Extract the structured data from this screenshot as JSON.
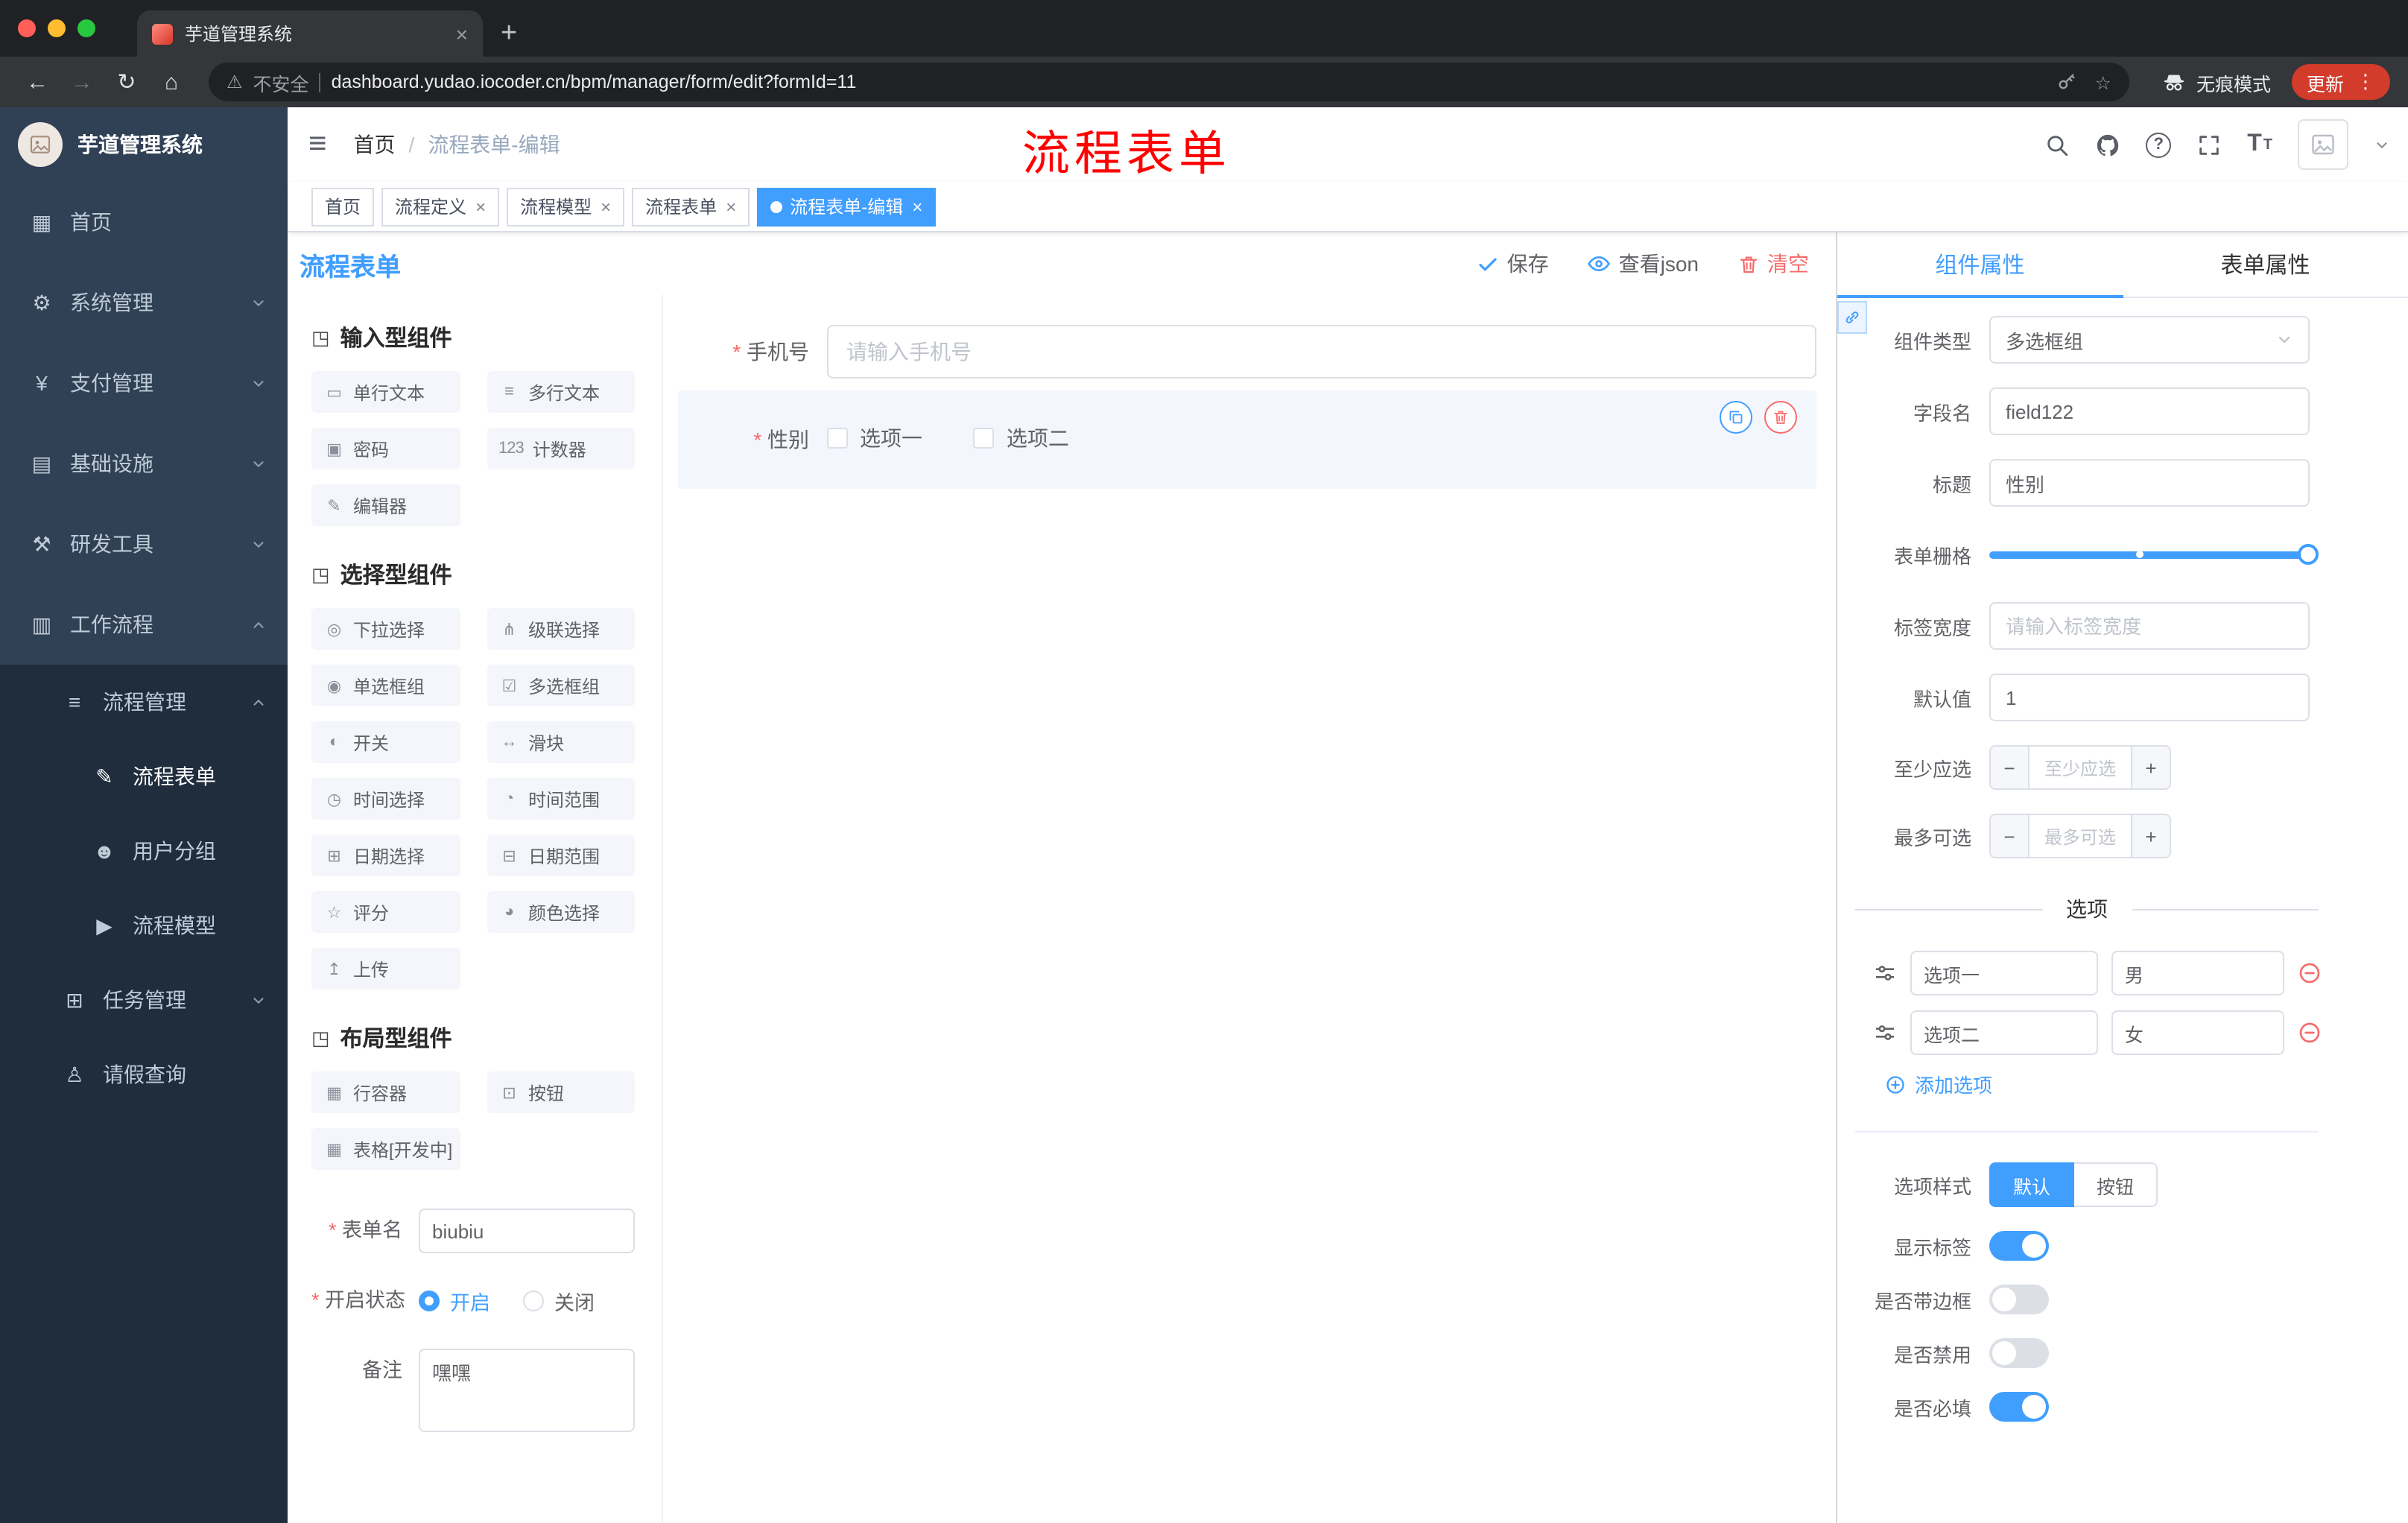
{
  "glyphs": {
    "close": "×",
    "plus": "+",
    "help": "?",
    "font_size": "T",
    "hamburger": "≡",
    "back": "←",
    "forward": "→",
    "reload": "↻",
    "home": "⌂",
    "warning": "⚠",
    "star": "☆",
    "dots": "⋮",
    "minus": "−"
  },
  "browser": {
    "tab": {
      "title": "芋道管理系统"
    },
    "security_label": "不安全",
    "url": "dashboard.yudao.iocoder.cn/bpm/manager/form/edit?formId=11",
    "incognito_label": "无痕模式",
    "update_label": "更新"
  },
  "sidebar": {
    "title": "芋道管理系统",
    "items": [
      {
        "label": "首页",
        "glyph": "▦"
      },
      {
        "label": "系统管理",
        "glyph": "⚙"
      },
      {
        "label": "支付管理",
        "glyph": "¥"
      },
      {
        "label": "基础设施",
        "glyph": "▤"
      },
      {
        "label": "研发工具",
        "glyph": "⚒"
      },
      {
        "label": "工作流程",
        "glyph": "▥"
      },
      {
        "label": "流程管理",
        "glyph": "≡"
      },
      {
        "label": "流程表单",
        "glyph": "✎"
      },
      {
        "label": "用户分组",
        "glyph": "☻"
      },
      {
        "label": "流程模型",
        "glyph": "▶"
      },
      {
        "label": "任务管理",
        "glyph": "⊞"
      },
      {
        "label": "请假查询",
        "glyph": "♙"
      }
    ]
  },
  "header": {
    "breadcrumb_home": "首页",
    "breadcrumb_sep": "/",
    "breadcrumb_current": "流程表单-编辑",
    "overlay_title": "流程表单"
  },
  "tags": [
    {
      "label": "首页"
    },
    {
      "label": "流程定义"
    },
    {
      "label": "流程模型"
    },
    {
      "label": "流程表单"
    },
    {
      "label": "流程表单-编辑"
    }
  ],
  "editor": {
    "title": "流程表单",
    "save": "保存",
    "view_json": "查看json",
    "clear": "清空",
    "palette": {
      "section_glyph": "◳",
      "sections": [
        {
          "title": "输入型组件",
          "items": [
            {
              "label": "单行文本",
              "glyph": "▭"
            },
            {
              "label": "多行文本",
              "glyph": "≡"
            },
            {
              "label": "密码",
              "glyph": "▣"
            },
            {
              "label": "计数器",
              "glyph": "123"
            },
            {
              "label": "编辑器",
              "glyph": "✎"
            }
          ]
        },
        {
          "title": "选择型组件",
          "items": [
            {
              "label": "下拉选择",
              "glyph": "◎"
            },
            {
              "label": "级联选择",
              "glyph": "⋔"
            },
            {
              "label": "单选框组",
              "glyph": "◉"
            },
            {
              "label": "多选框组",
              "glyph": "☑"
            },
            {
              "label": "开关",
              "glyph": "◐"
            },
            {
              "label": "滑块",
              "glyph": "↔"
            },
            {
              "label": "时间选择",
              "glyph": "◷"
            },
            {
              "label": "时间范围",
              "glyph": "◔"
            },
            {
              "label": "日期选择",
              "glyph": "⊞"
            },
            {
              "label": "日期范围",
              "glyph": "⊟"
            },
            {
              "label": "评分",
              "glyph": "☆"
            },
            {
              "label": "颜色选择",
              "glyph": "◕"
            },
            {
              "label": "上传",
              "glyph": "↥"
            }
          ]
        },
        {
          "title": "布局型组件",
          "items": [
            {
              "label": "行容器",
              "glyph": "▦"
            },
            {
              "label": "按钮",
              "glyph": "⊡"
            },
            {
              "label": "表格[开发中]",
              "glyph": "▦"
            }
          ]
        }
      ]
    },
    "meta": {
      "form_name_label": "表单名",
      "form_name_value": "biubiu",
      "status_label": "开启状态",
      "status_on": "开启",
      "status_off": "关闭",
      "remark_label": "备注",
      "remark_value": "嘿嘿"
    },
    "canvas": {
      "phone_label": "手机号",
      "phone_placeholder": "请输入手机号",
      "gender_label": "性别",
      "gender_option1": "选项一",
      "gender_option2": "选项二"
    }
  },
  "props": {
    "tab_component": "组件属性",
    "tab_form": "表单属性",
    "component_type_label": "组件类型",
    "component_type_value": "多选框组",
    "field_name_label": "字段名",
    "field_name_value": "field122",
    "title_label": "标题",
    "title_value": "性别",
    "grid_label": "表单栅格",
    "label_width_label": "标签宽度",
    "label_width_placeholder": "请输入标签宽度",
    "default_label": "默认值",
    "default_value": "1",
    "min_label": "至少应选",
    "min_placeholder": "至少应选",
    "max_label": "最多可选",
    "max_placeholder": "最多可选",
    "options_title": "选项",
    "options": [
      {
        "label": "选项一",
        "value": "男"
      },
      {
        "label": "选项二",
        "value": "女"
      }
    ],
    "add_option": "添加选项",
    "style_label": "选项样式",
    "style_default": "默认",
    "style_button": "按钮",
    "toggle_show_label": "显示标签",
    "toggle_border": "是否带边框",
    "toggle_disabled": "是否禁用",
    "toggle_required": "是否必填"
  },
  "colors": {
    "accent": "#409EFF",
    "danger": "#F56C6C",
    "sidebar_bg": "#304156",
    "submenu_bg": "#1F2D3D",
    "overlay_red": "#FF0000"
  }
}
